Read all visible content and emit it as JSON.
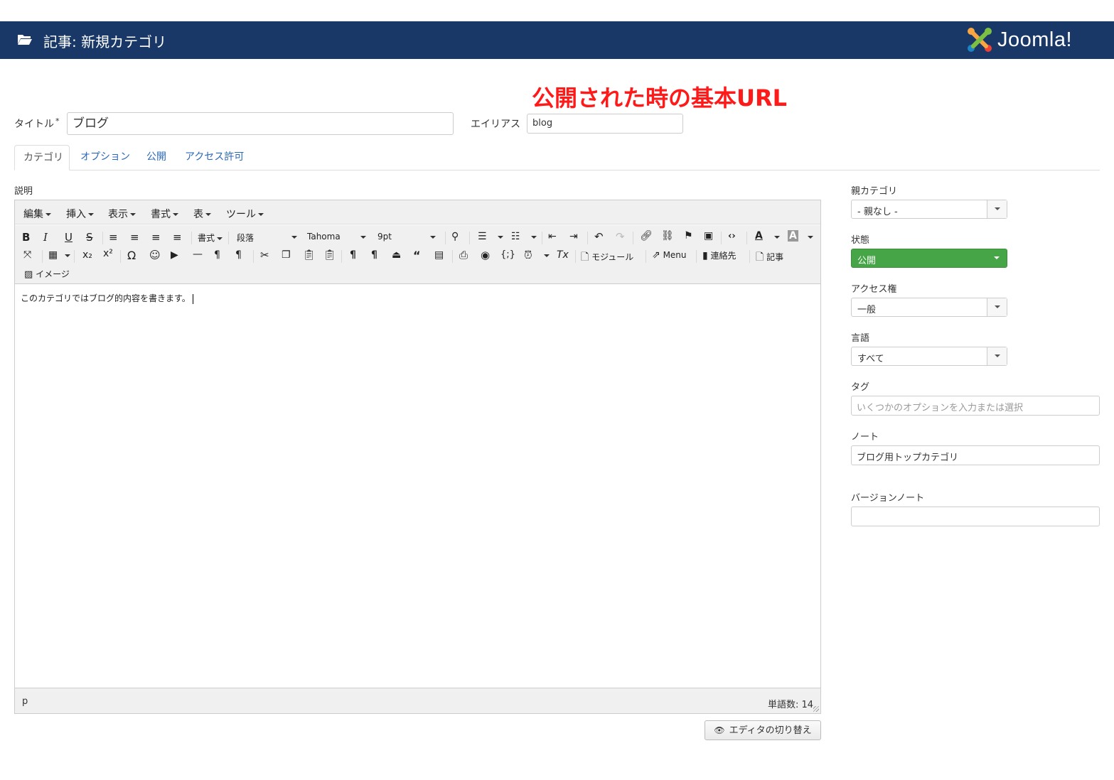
{
  "header": {
    "title": "記事: 新規カテゴリ",
    "icon": "folder-open-icon",
    "logo_text": "Joomla!"
  },
  "annotation": "公開された時の基本URL",
  "form": {
    "title_label": "タイトル",
    "required_mark": "*",
    "title_value": "ブログ",
    "alias_label": "エイリアス",
    "alias_value": "blog"
  },
  "tabs": [
    "カテゴリ",
    "オプション",
    "公開",
    "アクセス許可"
  ],
  "description_label": "説明",
  "editor": {
    "menus": [
      "編集",
      "挿入",
      "表示",
      "書式",
      "表",
      "ツール"
    ],
    "format_select": "書式",
    "block_select": "段落",
    "font_select": "Tahoma",
    "size_select": "9pt",
    "buttons": {
      "module": "モジュール",
      "menu": "Menu",
      "contact": "連絡先",
      "article": "記事",
      "image": "イメージ"
    },
    "content": "このカテゴリではブログ的内容を書きます。",
    "status_path": "p",
    "word_count": "単語数: 14"
  },
  "toggle_editor": "エディタの切り替え",
  "sidebar": {
    "parent": {
      "label": "親カテゴリ",
      "value": "- 親なし -"
    },
    "status": {
      "label": "状態",
      "value": "公開",
      "color": "#46a546"
    },
    "access": {
      "label": "アクセス権",
      "value": "一般"
    },
    "language": {
      "label": "言語",
      "value": "すべて"
    },
    "tags": {
      "label": "タグ",
      "placeholder": "いくつかのオプションを入力または選択"
    },
    "note": {
      "label": "ノート",
      "value": "ブログ用トップカテゴリ"
    },
    "version_note": {
      "label": "バージョンノート",
      "value": ""
    }
  },
  "colors": {
    "header_bg": "#1a3867",
    "annotation": "#ff1a1a",
    "link": "#2a69b8"
  }
}
